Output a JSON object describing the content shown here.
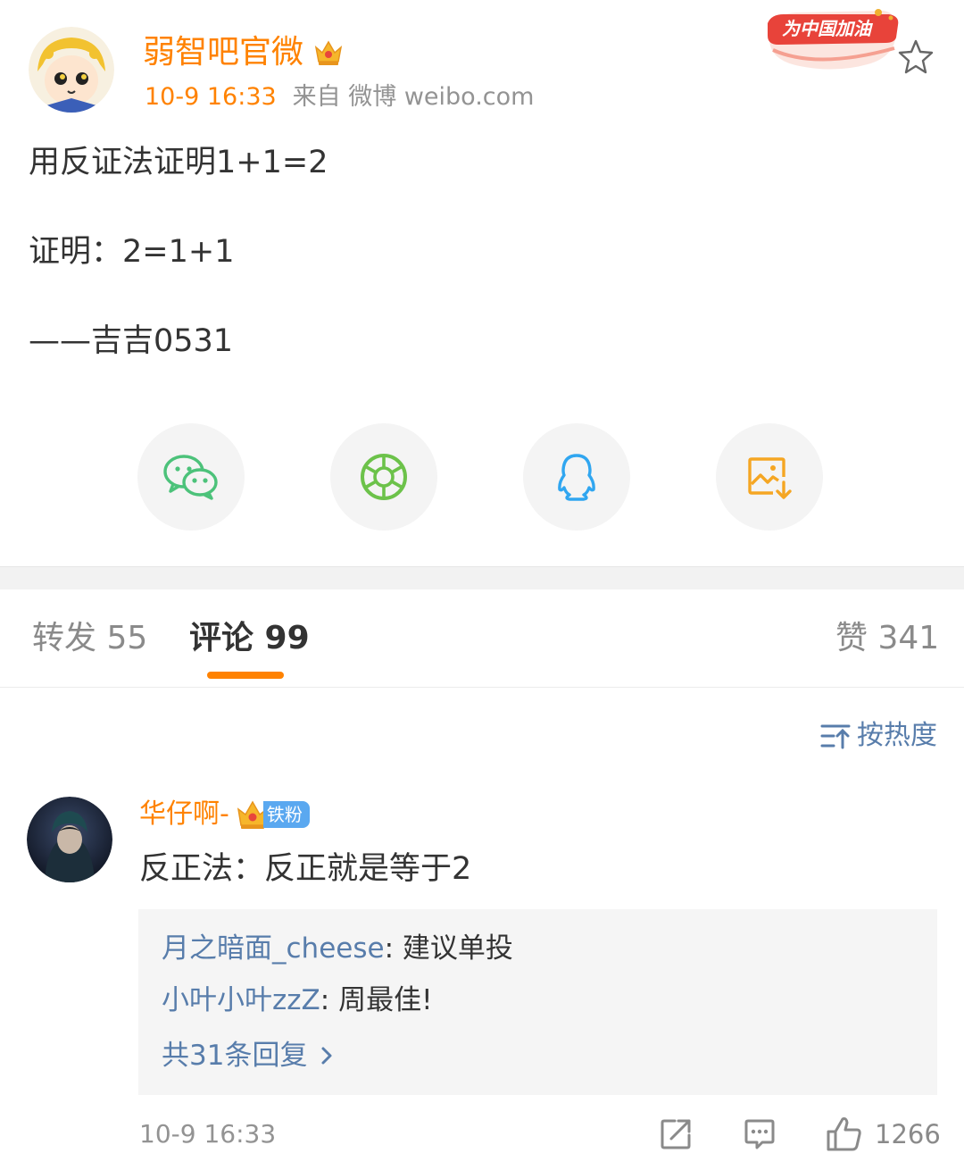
{
  "post": {
    "author": "弱智吧官微",
    "time": "10-9 16:33",
    "source": "来自 微博 weibo.com",
    "badge_text": "为中国加油",
    "lines": [
      "用反证法证明1+1=2",
      "证明：2=1+1",
      "——吉吉0531"
    ],
    "share_targets": [
      "wechat-icon",
      "moments-icon",
      "qq-icon",
      "save-image-icon"
    ]
  },
  "tabs": {
    "repost": "转发 55",
    "comments": "评论 99",
    "likes": "赞 341"
  },
  "sort_label": "按热度",
  "comment": {
    "user": "华仔啊-",
    "badge": "铁粉",
    "text": "反正法：反正就是等于2",
    "replies": [
      {
        "name": "月之暗面_cheese",
        "text": ": 建议单投"
      },
      {
        "name": "小叶小叶zzZ",
        "text": ": 周最佳!"
      }
    ],
    "more_replies": "共31条回复",
    "time": "10-9 16:33",
    "like_count": "1266"
  },
  "colors": {
    "accent": "#ff8200",
    "link": "#587dab",
    "badge_blue": "#5aa8f0"
  }
}
